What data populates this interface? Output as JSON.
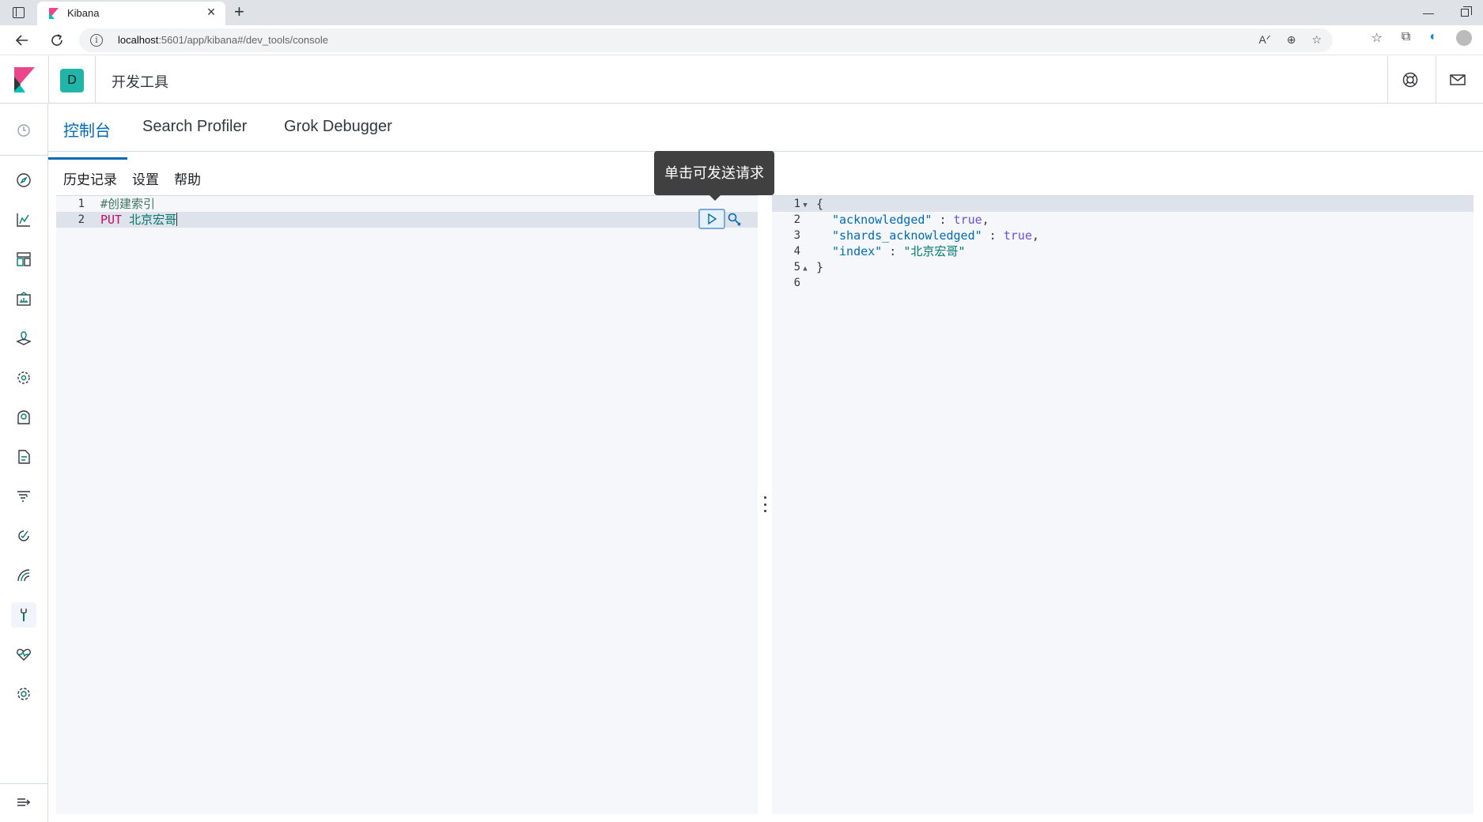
{
  "browser": {
    "tab_title": "Kibana",
    "url_host": "localhost",
    "url_rest": ":5601/app/kibana#/dev_tools/console"
  },
  "header": {
    "space_letter": "D",
    "breadcrumb": "开发工具"
  },
  "tabs": [
    {
      "label": "控制台",
      "active": true
    },
    {
      "label": "Search Profiler",
      "active": false
    },
    {
      "label": "Grok Debugger",
      "active": false
    }
  ],
  "console_menu": [
    "历史记录",
    "设置",
    "帮助"
  ],
  "tooltip": "单击可发送请求",
  "request": {
    "line_numbers": [
      "1",
      "2"
    ],
    "comment": "#创建索引",
    "method": "PUT",
    "url": "北京宏哥"
  },
  "response": {
    "line_numbers": [
      "1",
      "2",
      "3",
      "4",
      "5",
      "6"
    ],
    "open_brace": "{",
    "close_brace": "}",
    "fields": [
      {
        "key": "\"acknowledged\"",
        "value": "true",
        "comma": ","
      },
      {
        "key": "\"shards_acknowledged\"",
        "value": "true",
        "comma": ","
      },
      {
        "key": "\"index\"",
        "value": "\"北京宏哥\"",
        "comma": ""
      }
    ]
  },
  "sidenav_icons": [
    "recent-icon",
    "discover-icon",
    "visualize-icon",
    "dashboard-icon",
    "canvas-icon",
    "maps-icon",
    "ml-icon",
    "infrastructure-icon",
    "logs-icon",
    "apm-icon",
    "uptime-icon",
    "siem-icon",
    "dev-tools-icon",
    "monitoring-icon",
    "management-icon",
    "collapse-icon"
  ]
}
